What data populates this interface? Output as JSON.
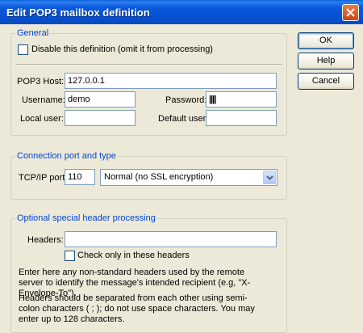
{
  "window": {
    "title": "Edit POP3 mailbox definition"
  },
  "buttons": {
    "ok": "OK",
    "help": "Help",
    "cancel": "Cancel"
  },
  "general": {
    "legend": "General",
    "disable_label": "Disable this definition (omit it from processing)",
    "disable_checked": false,
    "pop3_host_label": "POP3 Host:",
    "pop3_host_value": "127.0.0.1",
    "username_label": "Username:",
    "username_value": "demo",
    "password_label": "Password:",
    "password_value": "||||",
    "local_user_label": "Local user:",
    "local_user_value": "",
    "default_user_label": "Default user:",
    "default_user_value": ""
  },
  "connection": {
    "legend": "Connection port and type",
    "port_label": "TCP/IP port:",
    "port_value": "110",
    "type_value": "Normal (no SSL encryption)"
  },
  "headers": {
    "legend": "Optional special header processing",
    "headers_label": "Headers:",
    "headers_value": "",
    "check_only_label": "Check only in these headers",
    "check_only_checked": false,
    "help1": "Enter here any non-standard headers used by the remote server to identify the message's intended recipient (e.g, \"X-Envelope-To\").",
    "help2": "Headers should be separated from each other using semi-colon characters ( ; ); do not use space characters. You may enter up to 128 characters."
  },
  "icons": {
    "close": "close-icon",
    "dropdown": "chevron-down-icon"
  },
  "colors": {
    "titlebar": "#0a5fd6",
    "legend_text": "#0046d5",
    "face": "#ece9d8"
  }
}
